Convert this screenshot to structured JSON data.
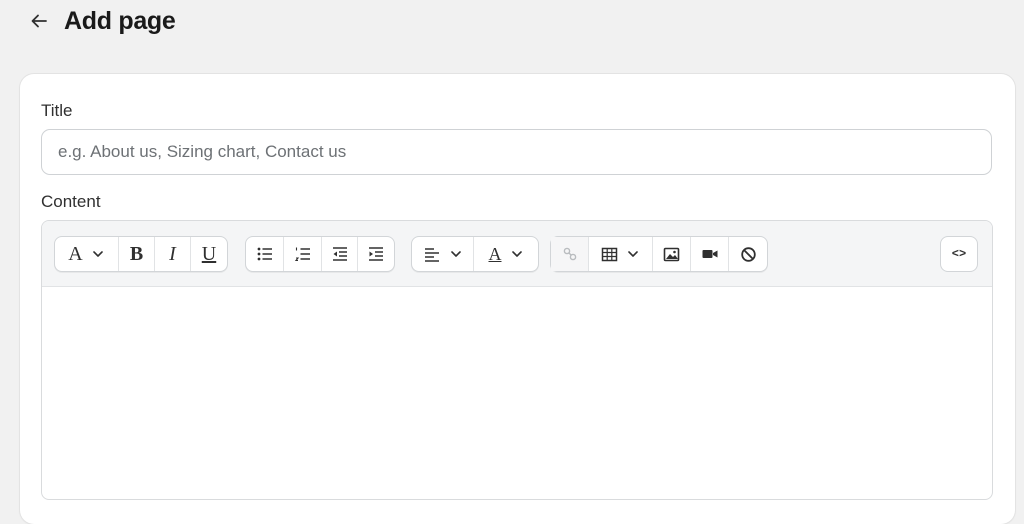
{
  "header": {
    "back_icon": "arrow-left-icon",
    "title": "Add page"
  },
  "form": {
    "title_label": "Title",
    "title_placeholder": "e.g. About us, Sizing chart, Contact us",
    "title_value": "",
    "content_label": "Content",
    "content_value": ""
  },
  "toolbar": {
    "text_style_glyph": "A",
    "bold_glyph": "B",
    "italic_glyph": "I",
    "underline_glyph": "U",
    "text_color_glyph": "A",
    "source_glyph": "<>",
    "icons": [
      "chevron-down-icon",
      "bullet-list-icon",
      "numbered-list-icon",
      "outdent-icon",
      "indent-icon",
      "align-left-icon",
      "link-icon",
      "table-icon",
      "image-icon",
      "video-icon",
      "clear-formatting-icon",
      "code-view-icon"
    ]
  }
}
